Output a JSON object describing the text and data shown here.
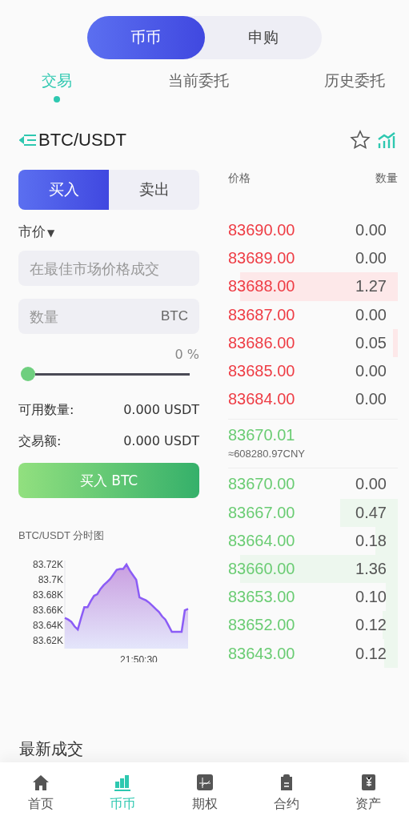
{
  "mode_switch": [
    {
      "label": "币币",
      "selected": true
    },
    {
      "label": "申购",
      "selected": false
    }
  ],
  "tabs": [
    {
      "label": "交易",
      "selected": true
    },
    {
      "label": "当前委托",
      "selected": false
    },
    {
      "label": "历史委托",
      "selected": false
    }
  ],
  "pair": {
    "title": "BTC/USDT",
    "favorite": false
  },
  "side_switch": [
    {
      "label": "买入",
      "selected": true
    },
    {
      "label": "卖出",
      "selected": false
    }
  ],
  "order_type": "市价",
  "order_type_caret": "▼",
  "price_field": {
    "placeholder": "在最佳市场价格成交"
  },
  "amount_field": {
    "placeholder": "数量",
    "unit": "BTC"
  },
  "slider": {
    "level": 0,
    "reading": "0 %"
  },
  "available": {
    "label": "可用数量:",
    "value": "0.000 USDT"
  },
  "turnover": {
    "label": "交易额:",
    "value": "0.000 USDT"
  },
  "submit_button": "买入 BTC",
  "chart": {
    "title": "BTC/USDT 分时图",
    "chart_data": {
      "type": "area",
      "categories": [
        null,
        null,
        null,
        null,
        null,
        null,
        null,
        null,
        null,
        null,
        null,
        null,
        null,
        null,
        null,
        null,
        null,
        null,
        null,
        null,
        null,
        null,
        null,
        null,
        null,
        null,
        null,
        null,
        null,
        null,
        null,
        null,
        null,
        null,
        null,
        null,
        null,
        null,
        null
      ],
      "annotations": [
        "21:50:30"
      ],
      "series": [
        {
          "color": "#8b5cf6",
          "values": [
            83.65,
            83.648,
            83.645,
            83.639,
            83.635,
            83.65,
            83.664,
            83.664,
            83.672,
            83.679,
            83.681,
            83.688,
            83.693,
            83.697,
            83.701,
            83.707,
            83.713,
            83.714,
            83.714,
            83.72,
            83.712,
            83.706,
            83.7,
            83.677,
            83.675,
            83.673,
            83.67,
            83.666,
            83.662,
            83.658,
            83.652,
            83.648,
            83.64,
            83.632,
            83.632,
            83.632,
            83.632,
            83.66,
            83.662
          ]
        }
      ],
      "ylim": [
        83.61,
        83.725
      ],
      "yticks": [
        {
          "value": 83.62,
          "label": "83.62K"
        },
        {
          "value": 83.64,
          "label": "83.64K"
        },
        {
          "value": 83.66,
          "label": "83.66K"
        },
        {
          "value": 83.68,
          "label": "83.68K"
        },
        {
          "value": 83.7,
          "label": "83.7K"
        },
        {
          "value": 83.72,
          "label": "83.72K"
        }
      ]
    }
  },
  "order_book": {
    "columns": [
      "价格",
      "数量"
    ],
    "asks": [
      {
        "price": "83690.00",
        "amount": "0.00"
      },
      {
        "price": "83689.00",
        "amount": "0.00"
      },
      {
        "price": "83688.00",
        "amount": "1.27",
        "level": 0.93
      },
      {
        "price": "83687.00",
        "amount": "0.00"
      },
      {
        "price": "83686.00",
        "amount": "0.05",
        "level": 0.03
      },
      {
        "price": "83685.00",
        "amount": "0.00"
      },
      {
        "price": "83684.00",
        "amount": "0.00"
      }
    ],
    "last_price": "83670.01",
    "last_price_cny": "≈608280.97CNY",
    "bids": [
      {
        "price": "83670.00",
        "amount": "0.00"
      },
      {
        "price": "83667.00",
        "amount": "0.47",
        "level": 0.34
      },
      {
        "price": "83664.00",
        "amount": "0.18",
        "level": 0.13
      },
      {
        "price": "83660.00",
        "amount": "1.36",
        "level": 0.93
      },
      {
        "price": "83653.00",
        "amount": "0.10",
        "level": 0.07
      },
      {
        "price": "83652.00",
        "amount": "0.12",
        "level": 0.09
      },
      {
        "price": "83643.00",
        "amount": "0.12",
        "level": 0.08
      }
    ]
  },
  "section_title": "最新成交",
  "tab_bar": [
    {
      "label": "首页",
      "selected": false
    },
    {
      "label": "币币",
      "selected": true
    },
    {
      "label": "期权",
      "selected": false
    },
    {
      "label": "合约",
      "selected": false
    },
    {
      "label": "资产",
      "selected": false
    }
  ]
}
